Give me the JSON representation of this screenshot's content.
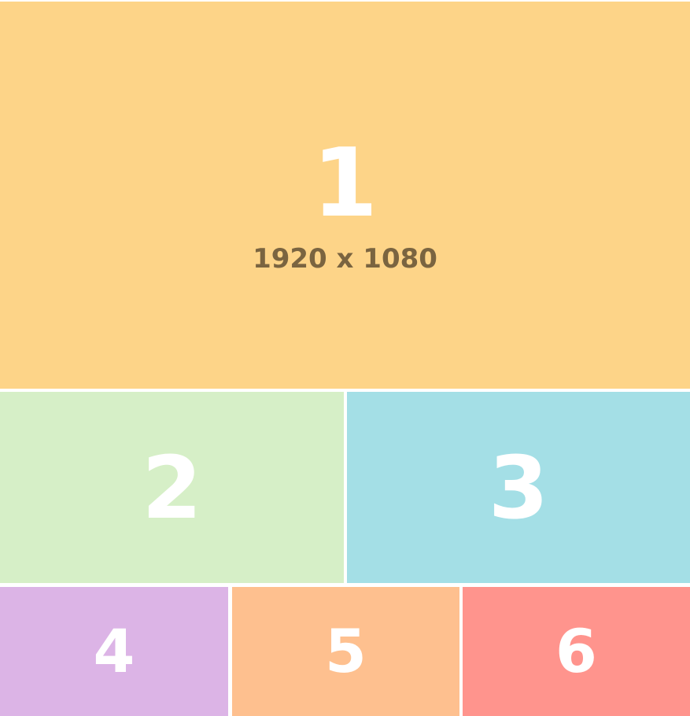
{
  "tiles": [
    {
      "label": "1",
      "resolution": "1920 x 1080",
      "color": "#fdd488"
    },
    {
      "label": "2",
      "color": "#d6efc7"
    },
    {
      "label": "3",
      "color": "#a4dfe6"
    },
    {
      "label": "4",
      "color": "#dcb4e6"
    },
    {
      "label": "5",
      "color": "#fec08f"
    },
    {
      "label": "6",
      "color": "#ff948d"
    }
  ]
}
